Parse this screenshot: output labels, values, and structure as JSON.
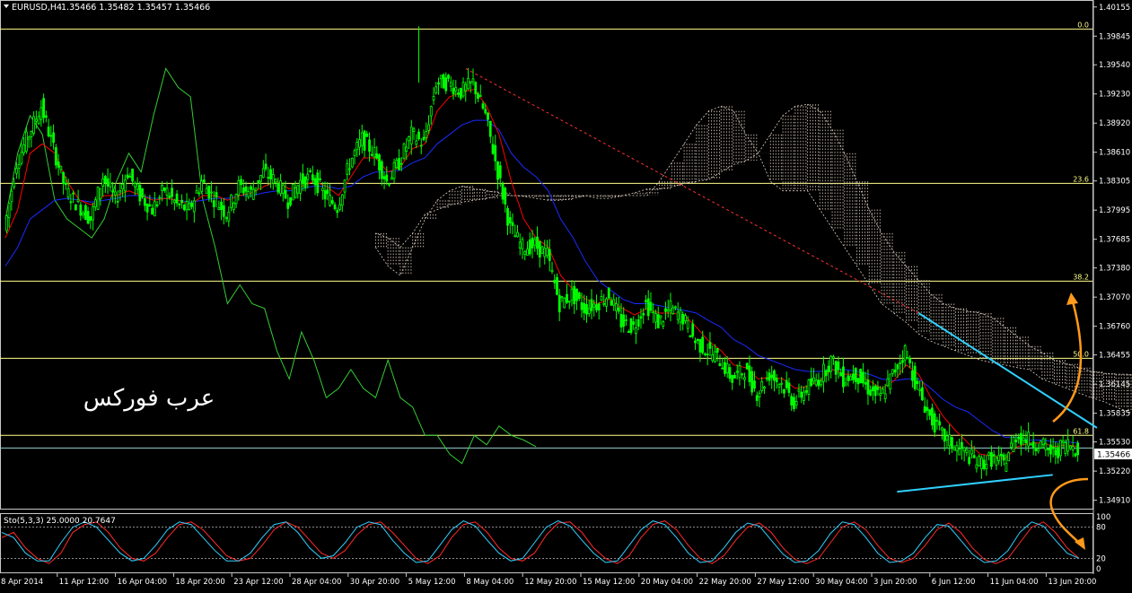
{
  "chart_data": [
    {
      "type": "candlestick",
      "symbol_label": "EURUSD,H4",
      "ohlc_label": "1.35466 1.35482 1.35457 1.35466",
      "last_price": 1.35466,
      "last_price_label": "1.35466",
      "y_ticks": [
        "1.40155",
        "1.39845",
        "1.39540",
        "1.39230",
        "1.38920",
        "1.38610",
        "1.38305",
        "1.37995",
        "1.37685",
        "1.37380",
        "1.37070",
        "1.36760",
        "1.36455",
        "1.36145",
        "1.35835",
        "1.35530",
        "1.35220",
        "1.34910"
      ],
      "x_ticks": [
        "8 Apr 2014",
        "11 Apr 12:00",
        "16 Apr 04:00",
        "18 Apr 20:00",
        "23 Apr 12:00",
        "28 Apr 04:00",
        "30 Apr 20:00",
        "5 May 12:00",
        "8 May 04:00",
        "12 May 20:00",
        "15 May 12:00",
        "20 May 04:00",
        "22 May 20:00",
        "27 May 12:00",
        "30 May 04:00",
        "3 Jun 20:00",
        "6 Jun 12:00",
        "11 Jun 04:00",
        "13 Jun 20:00"
      ],
      "fib_levels": [
        {
          "label": "0.0",
          "price": 1.3992
        },
        {
          "label": "23.6",
          "price": 1.3828
        },
        {
          "label": "38.2",
          "price": 1.3724
        },
        {
          "label": "50.0",
          "price": 1.3642
        },
        {
          "label": "61.8",
          "price": 1.356
        }
      ],
      "price_range": [
        1.3483,
        1.4021
      ],
      "close_series": [
        1.3778,
        1.385,
        1.388,
        1.391,
        1.3865,
        1.382,
        1.3805,
        1.379,
        1.3835,
        1.381,
        1.384,
        1.3815,
        1.38,
        1.3822,
        1.3805,
        1.38,
        1.383,
        1.3812,
        1.3796,
        1.3825,
        1.3818,
        1.384,
        1.383,
        1.381,
        1.383,
        1.3835,
        1.3815,
        1.3803,
        1.385,
        1.3875,
        1.386,
        1.383,
        1.385,
        1.388,
        1.387,
        1.3935,
        1.3935,
        1.3925,
        1.3935,
        1.39,
        1.384,
        1.378,
        1.376,
        1.3762,
        1.3752,
        1.37,
        1.371,
        1.3695,
        1.37,
        1.371,
        1.368,
        1.3675,
        1.37,
        1.368,
        1.3695,
        1.3685,
        1.366,
        1.365,
        1.364,
        1.362,
        1.363,
        1.3605,
        1.3625,
        1.3615,
        1.3595,
        1.361,
        1.362,
        1.364,
        1.362,
        1.3625,
        1.361,
        1.36,
        1.3625,
        1.365,
        1.361,
        1.358,
        1.356,
        1.3548,
        1.354,
        1.353,
        1.3535,
        1.353,
        1.356,
        1.3555,
        1.355,
        1.354,
        1.3552,
        1.3546
      ],
      "tenkan_series": [
        1.377,
        1.38,
        1.386,
        1.387,
        1.386,
        1.383,
        1.381,
        1.3805,
        1.3815,
        1.3815,
        1.382,
        1.3815,
        1.381,
        1.3812,
        1.381,
        1.3805,
        1.3815,
        1.3815,
        1.381,
        1.3815,
        1.3818,
        1.3825,
        1.383,
        1.3822,
        1.3825,
        1.383,
        1.3825,
        1.3815,
        1.3835,
        1.3855,
        1.3855,
        1.384,
        1.3845,
        1.3865,
        1.387,
        1.3905,
        1.392,
        1.3925,
        1.3928,
        1.391,
        1.388,
        1.383,
        1.379,
        1.377,
        1.376,
        1.373,
        1.3715,
        1.3705,
        1.37,
        1.3705,
        1.3695,
        1.3688,
        1.3695,
        1.369,
        1.369,
        1.3688,
        1.3675,
        1.366,
        1.365,
        1.3635,
        1.3632,
        1.362,
        1.3622,
        1.362,
        1.361,
        1.3612,
        1.3618,
        1.363,
        1.3625,
        1.3625,
        1.3618,
        1.361,
        1.3618,
        1.3635,
        1.3625,
        1.36,
        1.358,
        1.3565,
        1.3552,
        1.354,
        1.3538,
        1.3535,
        1.3548,
        1.3552,
        1.3552,
        1.3548,
        1.355,
        1.3548
      ],
      "kijun_series": [
        1.374,
        1.376,
        1.379,
        1.38,
        1.381,
        1.3812,
        1.381,
        1.3808,
        1.381,
        1.3812,
        1.3815,
        1.3815,
        1.3812,
        1.3812,
        1.381,
        1.3808,
        1.381,
        1.3812,
        1.3812,
        1.3815,
        1.3815,
        1.3818,
        1.382,
        1.382,
        1.3822,
        1.3825,
        1.3825,
        1.3822,
        1.3825,
        1.3835,
        1.384,
        1.384,
        1.3842,
        1.385,
        1.3855,
        1.387,
        1.388,
        1.389,
        1.3895,
        1.3895,
        1.3885,
        1.386,
        1.3845,
        1.3835,
        1.382,
        1.379,
        1.377,
        1.3745,
        1.3725,
        1.3715,
        1.3705,
        1.37,
        1.37,
        1.3698,
        1.3695,
        1.3693,
        1.369,
        1.3682,
        1.3675,
        1.3662,
        1.3655,
        1.3645,
        1.364,
        1.3635,
        1.363,
        1.3628,
        1.3628,
        1.363,
        1.363,
        1.3628,
        1.3625,
        1.362,
        1.3618,
        1.362,
        1.362,
        1.361,
        1.3598,
        1.359,
        1.3585,
        1.3575,
        1.3565,
        1.3558,
        1.3558,
        1.3555,
        1.3555,
        1.3553,
        1.3553,
        1.3552
      ],
      "chikou_series": [
        1.379,
        1.386,
        1.39,
        1.388,
        1.381,
        1.379,
        1.378,
        1.377,
        1.379,
        1.383,
        1.386,
        1.384,
        1.39,
        1.395,
        1.393,
        1.392,
        1.381,
        1.376,
        1.37,
        1.372,
        1.37,
        1.3695,
        1.365,
        1.362,
        1.367,
        1.364,
        1.36,
        1.361,
        1.363,
        1.361,
        1.36,
        1.364,
        1.36,
        1.359,
        1.356,
        1.356,
        1.354,
        1.353,
        1.356,
        1.355,
        1.357,
        1.356,
        1.3555,
        1.3548
      ],
      "senkou_a_series": [
        1.376,
        1.374,
        1.373,
        1.376,
        1.379,
        1.381,
        1.382,
        1.3825,
        1.3822,
        1.382,
        1.3818,
        1.3815,
        1.3814,
        1.3812,
        1.381,
        1.381,
        1.3812,
        1.3815,
        1.3812,
        1.3812,
        1.3815,
        1.3818,
        1.3822,
        1.3822,
        1.3824,
        1.3828,
        1.383,
        1.3832,
        1.384,
        1.3848,
        1.3852,
        1.386,
        1.388,
        1.39,
        1.391,
        1.3912,
        1.3905,
        1.3885,
        1.386,
        1.383,
        1.38,
        1.3775,
        1.3755,
        1.374,
        1.3725,
        1.371,
        1.37,
        1.3695,
        1.3692,
        1.369,
        1.3685,
        1.3675,
        1.3665,
        1.3655,
        1.3648,
        1.364,
        1.3636,
        1.3632,
        1.3628,
        1.3626,
        1.3625,
        1.3625,
        1.362,
        1.3622,
        1.3624,
        1.3624,
        1.362,
        1.3612,
        1.3605,
        1.36,
        1.3594,
        1.3585
      ],
      "senkou_b_series": [
        1.3775,
        1.377,
        1.376,
        1.3775,
        1.3795,
        1.38,
        1.3805,
        1.3808,
        1.381,
        1.3812,
        1.3815,
        1.3815,
        1.3815,
        1.3815,
        1.3815,
        1.3815,
        1.3815,
        1.3815,
        1.3815,
        1.3815,
        1.3815,
        1.3815,
        1.3815,
        1.383,
        1.385,
        1.387,
        1.389,
        1.3905,
        1.391,
        1.3905,
        1.388,
        1.386,
        1.383,
        1.382,
        1.382,
        1.382,
        1.38,
        1.378,
        1.376,
        1.374,
        1.372,
        1.37,
        1.369,
        1.368,
        1.3668,
        1.366,
        1.3655,
        1.365,
        1.3645,
        1.364,
        1.3637,
        1.3635,
        1.3632,
        1.363,
        1.362,
        1.3615,
        1.361,
        1.3605,
        1.36,
        1.3596,
        1.359,
        1.3585,
        1.358,
        1.3578,
        1.3576,
        1.3575,
        1.3574,
        1.3573,
        1.3572,
        1.3572,
        1.3572,
        1.3572
      ],
      "trendlines": [
        {
          "name": "resistance-dashed",
          "color": "#ff3030",
          "points": [
            [
              0.4115,
              1.395
            ],
            [
              0.8115,
              1.369
            ]
          ]
        },
        {
          "name": "upper-triangle",
          "color": "#30d0ff",
          "points": [
            [
              0.8115,
              1.369
            ],
            [
              0.969,
              1.3568
            ]
          ]
        },
        {
          "name": "lower-triangle",
          "color": "#30d0ff",
          "points": [
            [
              0.7925,
              1.35
            ],
            [
              0.93,
              1.3518
            ]
          ]
        }
      ],
      "watermark_text": "عرب فوركس"
    },
    {
      "type": "line",
      "title": "Sto(5,3,3) 25.0000 20.7647",
      "ylim": [
        0,
        100
      ],
      "y_ticks": [
        "100",
        "80",
        "20",
        "0"
      ],
      "levels": [
        20,
        80
      ],
      "series": [
        {
          "color": "#ff2a2a",
          "values": [
            60,
            70,
            40,
            20,
            10,
            30,
            70,
            85,
            90,
            70,
            40,
            20,
            15,
            30,
            60,
            85,
            90,
            75,
            50,
            25,
            15,
            20,
            45,
            75,
            90,
            80,
            55,
            30,
            20,
            35,
            65,
            85,
            90,
            70,
            45,
            20,
            10,
            25,
            60,
            85,
            90,
            70,
            40,
            20,
            15,
            30,
            65,
            88,
            90,
            70,
            40,
            20,
            10,
            25,
            60,
            85,
            92,
            75,
            45,
            20,
            10,
            25,
            55,
            80,
            88,
            70,
            40,
            18,
            10,
            20,
            50,
            80,
            90,
            75,
            45,
            20,
            12,
            20,
            45,
            75,
            88,
            70,
            40,
            18,
            10,
            20,
            50,
            80,
            90,
            70,
            40,
            20
          ]
        },
        {
          "color": "#30d0ff",
          "values": [
            70,
            60,
            30,
            15,
            15,
            50,
            80,
            90,
            80,
            55,
            30,
            15,
            20,
            45,
            75,
            90,
            85,
            60,
            35,
            15,
            15,
            30,
            60,
            85,
            90,
            70,
            40,
            20,
            25,
            50,
            80,
            90,
            85,
            55,
            30,
            12,
            15,
            45,
            75,
            92,
            82,
            55,
            30,
            15,
            20,
            50,
            80,
            92,
            82,
            55,
            30,
            12,
            15,
            45,
            75,
            92,
            85,
            60,
            30,
            12,
            15,
            40,
            70,
            88,
            82,
            55,
            28,
            12,
            15,
            35,
            68,
            90,
            85,
            60,
            30,
            12,
            15,
            30,
            60,
            85,
            82,
            55,
            28,
            12,
            15,
            35,
            70,
            90,
            82,
            55,
            30,
            20
          ]
        }
      ]
    }
  ],
  "colors": {
    "background": "#000000",
    "grid_border": "#ffffff",
    "bull_candle": "#00ff00",
    "bear_candle": "#00ff00",
    "tenkan": "#ff0000",
    "kijun": "#1a2bff",
    "chikou": "#33cc33",
    "cloud": "#e0d0c0",
    "fib": "#ffff88",
    "arrow": "#ff9a1a",
    "text": "#ffffff"
  }
}
